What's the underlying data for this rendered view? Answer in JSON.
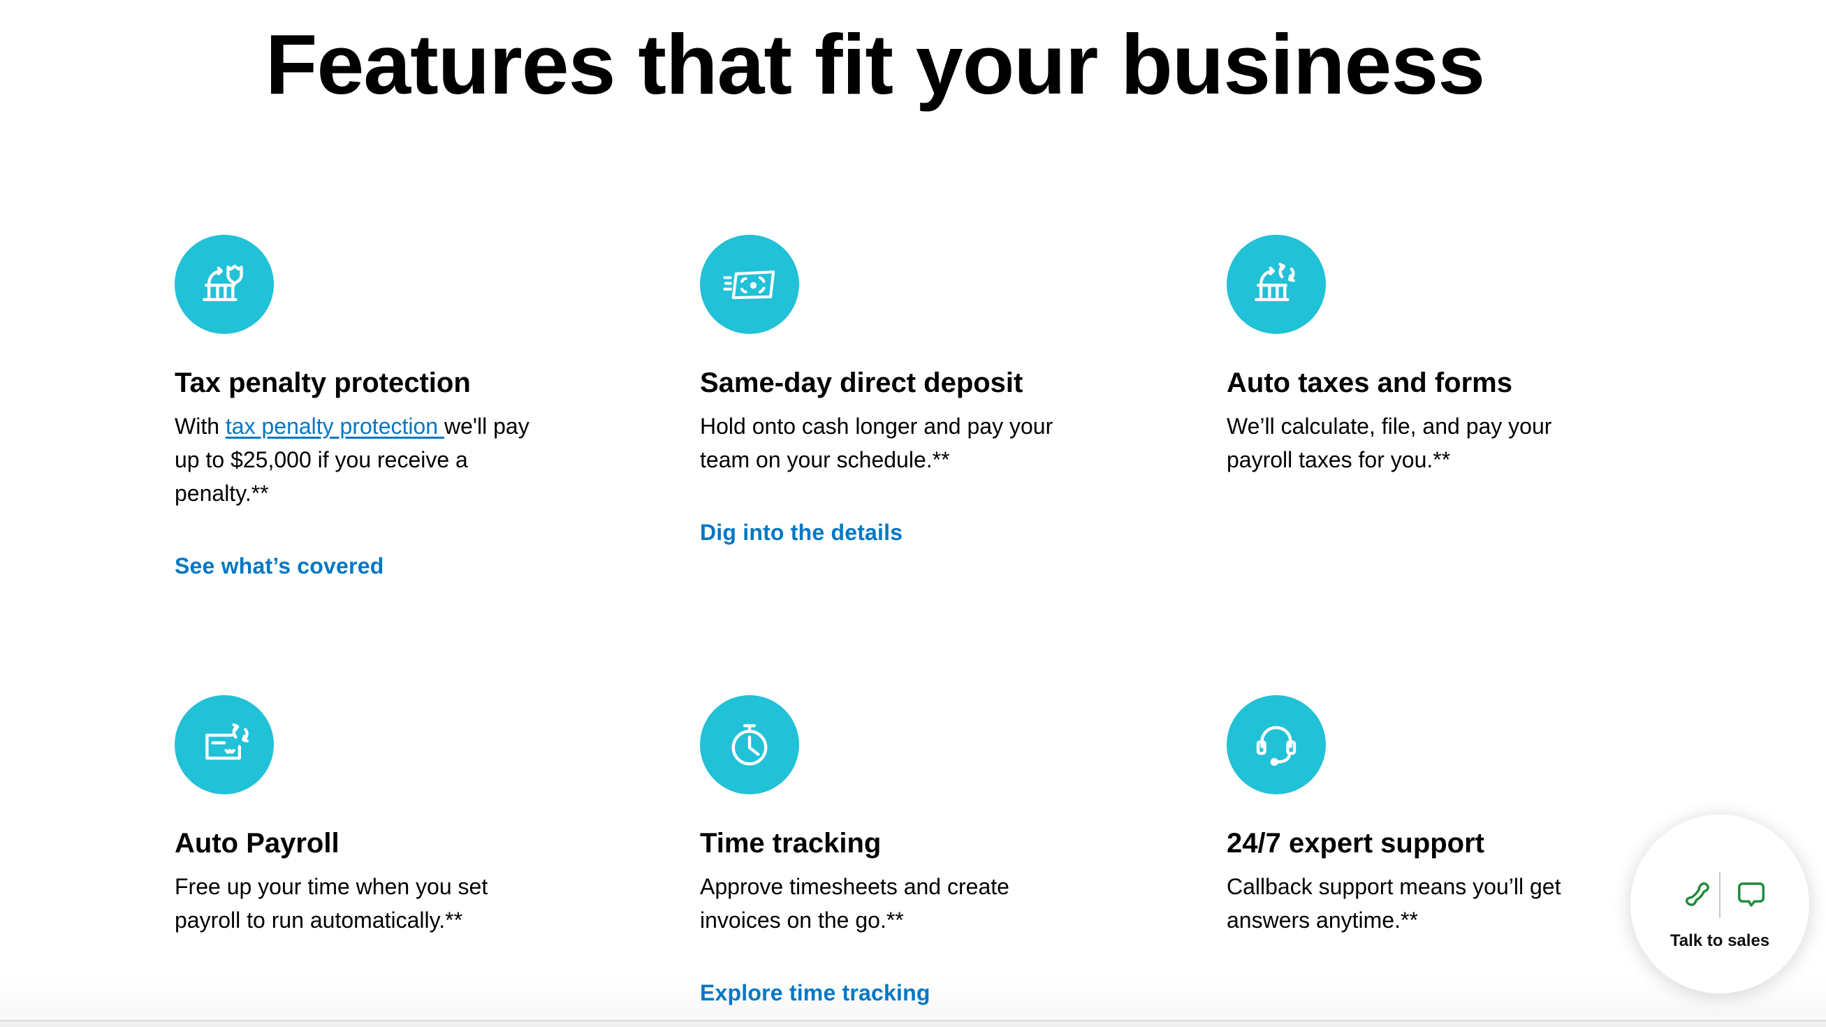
{
  "page": {
    "title": "Features that fit your business"
  },
  "colors": {
    "icon_circle": "#21C1D7",
    "link": "#0077C5",
    "sales_icon": "#1E8B3B"
  },
  "features": [
    {
      "icon": "bank-shield-icon",
      "title": "Tax penalty protection",
      "desc_prefix": "With ",
      "desc_link": "tax penalty protection ",
      "desc_suffix": "we'll pay up to $25,000 if you receive a penalty.**",
      "link": "See what’s covered"
    },
    {
      "icon": "money-transfer-icon",
      "title": "Same-day direct deposit",
      "desc": "Hold onto cash longer and pay your team on your schedule.**",
      "link": "Dig into the details"
    },
    {
      "icon": "bank-refresh-icon",
      "title": "Auto taxes and forms",
      "desc": "We’ll calculate, file, and pay your payroll taxes for you.**"
    },
    {
      "icon": "check-refresh-icon",
      "title": "Auto Payroll",
      "desc": "Free up your time when you set payroll to run automatically.**"
    },
    {
      "icon": "stopwatch-icon",
      "title": "Time tracking",
      "desc": "Approve timesheets and create invoices on the go.**",
      "link": "Explore time tracking"
    },
    {
      "icon": "headset-icon",
      "title": "24/7 expert support",
      "desc": "Callback support means you’ll get answers anytime.**"
    }
  ],
  "sales_widget": {
    "label": "Talk to sales",
    "phone_icon": "phone-icon",
    "chat_icon": "chat-bubble-icon"
  }
}
